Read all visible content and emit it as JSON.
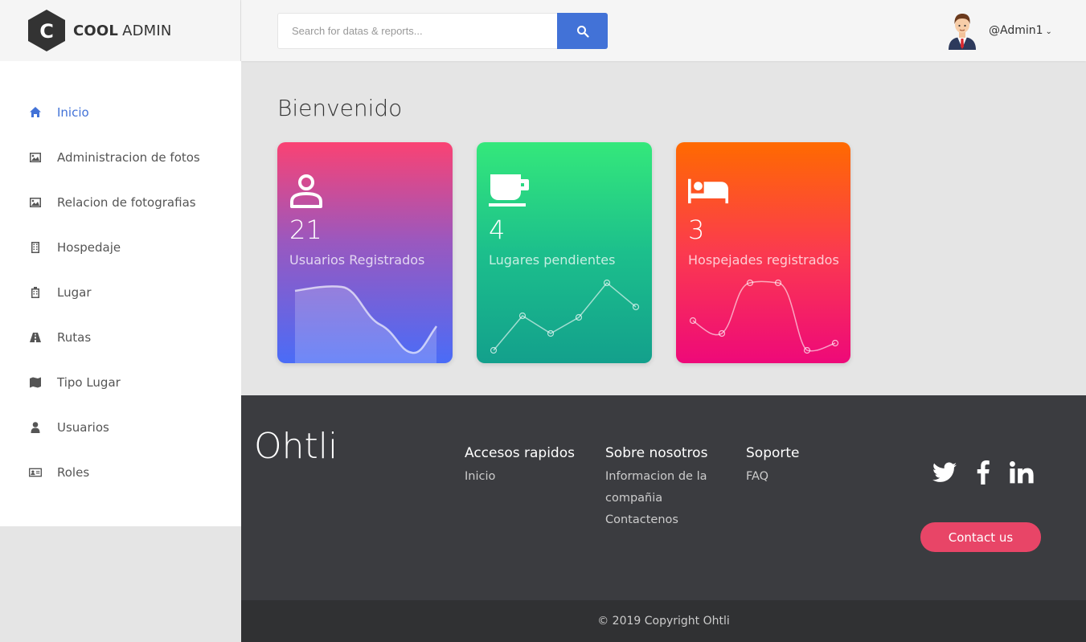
{
  "brand": {
    "bold": "COOL",
    "light": "ADMIN"
  },
  "search": {
    "placeholder": "Search for datas & reports..."
  },
  "user": {
    "name": "@Admin1"
  },
  "sidebar": {
    "items": [
      {
        "label": "Inicio",
        "icon": "home-icon",
        "active": true
      },
      {
        "label": "Administracion de fotos",
        "icon": "image-icon"
      },
      {
        "label": "Relacion de fotografias",
        "icon": "image-icon"
      },
      {
        "label": "Hospedaje",
        "icon": "building-icon"
      },
      {
        "label": "Lugar",
        "icon": "hospital-building-icon"
      },
      {
        "label": "Rutas",
        "icon": "road-icon"
      },
      {
        "label": "Tipo Lugar",
        "icon": "map-icon"
      },
      {
        "label": "Usuarios",
        "icon": "user-icon"
      },
      {
        "label": "Roles",
        "icon": "id-card-icon"
      }
    ]
  },
  "main": {
    "title": "Bienvenido",
    "cards": [
      {
        "value": "21",
        "label": "Usuarios Registrados",
        "icon": "user-outline-icon"
      },
      {
        "value": "4",
        "label": "Lugares pendientes",
        "icon": "coffee-cup-icon"
      },
      {
        "value": "3",
        "label": "Hospejades registrados",
        "icon": "bed-icon"
      }
    ]
  },
  "footer": {
    "brand": "Ohtli",
    "columns": [
      {
        "heading": "Accesos rapidos",
        "links": [
          "Inicio"
        ]
      },
      {
        "heading": "Sobre nosotros",
        "links": [
          "Informacion de la compañia",
          "Contactenos"
        ]
      },
      {
        "heading": "Soporte",
        "links": [
          "FAQ"
        ]
      }
    ],
    "social": [
      "twitter-icon",
      "facebook-icon",
      "linkedin-icon"
    ],
    "contact_label": "Contact us",
    "copyright": "© 2019 Copyright Ohtli"
  },
  "colors": {
    "accent": "#4272d7",
    "footer_bg": "#3b3c40",
    "contact_button": "#e84567"
  }
}
